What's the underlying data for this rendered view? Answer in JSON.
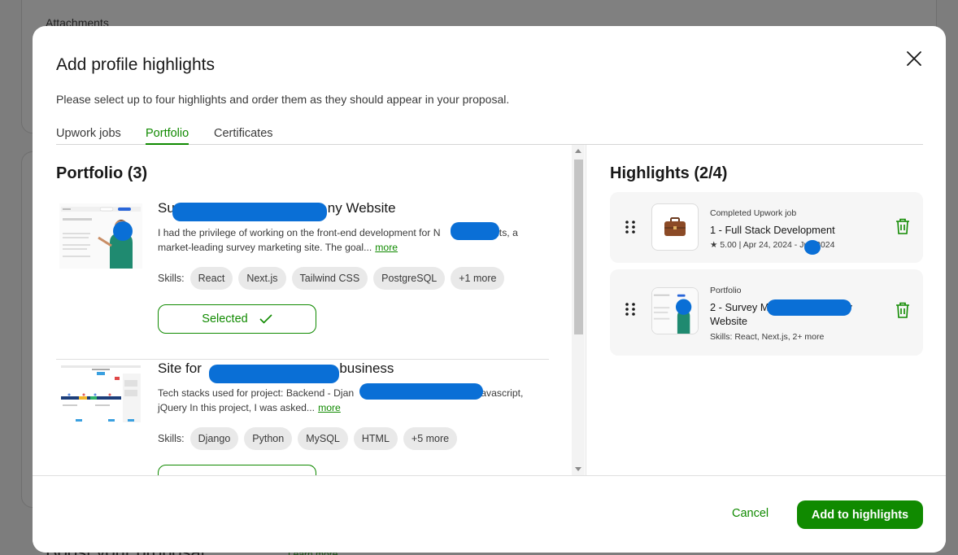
{
  "background": {
    "section_label": "Attachments",
    "footer_heading": "Boost your proposal",
    "footer_link": "Learn more"
  },
  "modal": {
    "title": "Add profile highlights",
    "subtitle": "Please select up to four highlights and order them as they should appear in your proposal.",
    "close_icon": "close-icon",
    "tabs": [
      {
        "label": "Upwork jobs",
        "active": false
      },
      {
        "label": "Portfolio",
        "active": true
      },
      {
        "label": "Certificates",
        "active": false
      }
    ]
  },
  "portfolio": {
    "title": "Portfolio (3)",
    "items": [
      {
        "title_start": "Su",
        "title_end": "ny Website",
        "desc_line1_start": "I had the privilege of working on the front-end development for N",
        "desc_line1_end": "ights, a",
        "desc_line2": "market-leading survey marketing site. The goal...",
        "more": "more",
        "skills_label": "Skills:",
        "skills": [
          "React",
          "Next.js",
          "Tailwind CSS",
          "PostgreSQL",
          "+1 more"
        ],
        "button_label": "Selected",
        "selected": true
      },
      {
        "title_start": "Site for ",
        "title_end": " business",
        "desc_line1_start": "Tech stacks used for project: Backend - Djan",
        "desc_line1_end": "Javascript,",
        "desc_line2": "jQuery In this project, I was asked...",
        "more": "more",
        "skills_label": "Skills:",
        "skills": [
          "Django",
          "Python",
          "MySQL",
          "HTML",
          "+5 more"
        ]
      }
    ]
  },
  "highlights": {
    "title": "Highlights (2/4)",
    "items": [
      {
        "type": "Completed Upwork job",
        "title": "1 - Full Stack Development",
        "meta": "★ 5.00 | Apr 24, 2024 - Ju   , 2024",
        "icon": "briefcase-icon"
      },
      {
        "type": "Portfolio",
        "title_start": "2 - Survey M",
        "title_end": "y",
        "title_line2": "Website",
        "meta": "Skills: React, Next.js, 2+ more"
      }
    ]
  },
  "footer": {
    "cancel_label": "Cancel",
    "add_label": "Add to highlights"
  },
  "colors": {
    "accent": "#108a00",
    "redaction": "#0a6fd6"
  }
}
